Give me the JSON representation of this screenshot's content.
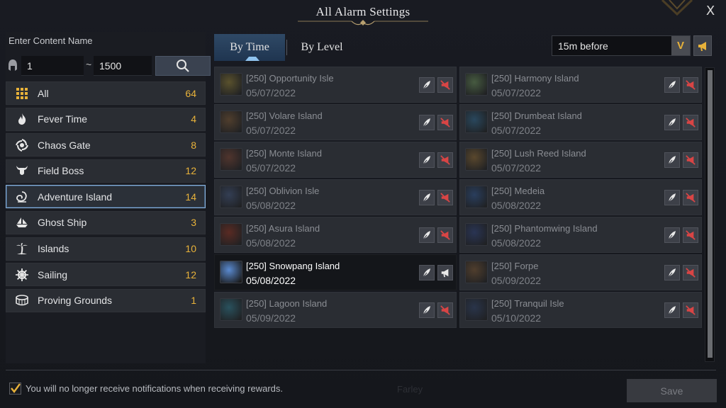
{
  "window": {
    "title": "All Alarm Settings",
    "close_label": "X"
  },
  "search": {
    "label": "Enter Content Name",
    "level_min": "1",
    "level_separator": "~",
    "level_max": "1500"
  },
  "categories": [
    {
      "label": "All",
      "count": "64",
      "icon": "grid-icon"
    },
    {
      "label": "Fever Time",
      "count": "4",
      "icon": "flame-icon"
    },
    {
      "label": "Chaos Gate",
      "count": "8",
      "icon": "vortex-icon"
    },
    {
      "label": "Field Boss",
      "count": "12",
      "icon": "horned-skull-icon"
    },
    {
      "label": "Adventure Island",
      "count": "14",
      "icon": "shell-icon",
      "selected": true
    },
    {
      "label": "Ghost Ship",
      "count": "3",
      "icon": "ship-icon"
    },
    {
      "label": "Islands",
      "count": "10",
      "icon": "palm-tree-icon"
    },
    {
      "label": "Sailing",
      "count": "12",
      "icon": "ship-wheel-icon"
    },
    {
      "label": "Proving Grounds",
      "count": "1",
      "icon": "arena-icon"
    }
  ],
  "tabs": [
    {
      "label": "By Time",
      "active": true
    },
    {
      "label": "By Level",
      "active": false
    }
  ],
  "dropdown": {
    "selected": "15m before",
    "arrow": "V"
  },
  "islands": [
    {
      "title": "[250] Opportunity Isle",
      "date": "05/07/2022",
      "thumb_color": "#7a6a2a"
    },
    {
      "title": "[250] Harmony Island",
      "date": "05/07/2022",
      "thumb_color": "#5a7a4a"
    },
    {
      "title": "[250] Volare Island",
      "date": "05/07/2022",
      "thumb_color": "#6a4a2a"
    },
    {
      "title": "[250] Drumbeat Island",
      "date": "05/07/2022",
      "thumb_color": "#2a5a7a"
    },
    {
      "title": "[250] Monte Island",
      "date": "05/07/2022",
      "thumb_color": "#6a3a2a"
    },
    {
      "title": "[250] Lush Reed Island",
      "date": "05/07/2022",
      "thumb_color": "#7a5a2a"
    },
    {
      "title": "[250] Oblivion Isle",
      "date": "05/08/2022",
      "thumb_color": "#3a4a6a"
    },
    {
      "title": "[250] Medeia",
      "date": "05/08/2022",
      "thumb_color": "#2a4a7a"
    },
    {
      "title": "[250] Asura Island",
      "date": "05/08/2022",
      "thumb_color": "#7a2a1a"
    },
    {
      "title": "[250] Phantomwing Island",
      "date": "05/08/2022",
      "thumb_color": "#2a3a6a"
    },
    {
      "title": "[250] Snowpang Island",
      "date": "05/08/2022",
      "thumb_color": "#5a8ad0",
      "active": true
    },
    {
      "title": "[250] Forpe",
      "date": "05/09/2022",
      "thumb_color": "#6a4a2a"
    },
    {
      "title": "[250] Lagoon Island",
      "date": "05/09/2022",
      "thumb_color": "#2a6a7a"
    },
    {
      "title": "[250] Tranquil Isle",
      "date": "05/10/2022",
      "thumb_color": "#2a3a5a"
    }
  ],
  "footer": {
    "checkbox_label": "You will no longer receive notifications when receiving rewards.",
    "checked": true,
    "watermark": "Farley",
    "save_label": "Save"
  },
  "colors": {
    "accent_gold": "#e8b23a",
    "selection_blue": "#8ab0d8",
    "mute_red": "#d94545"
  }
}
